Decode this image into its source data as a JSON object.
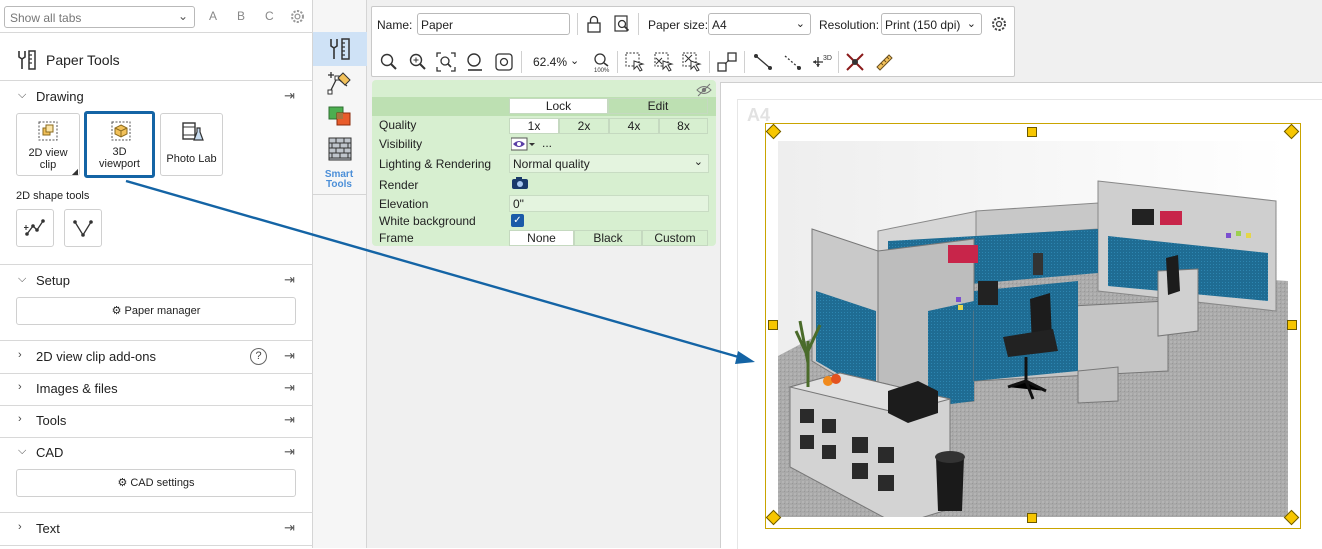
{
  "left_panel": {
    "tab_filter": {
      "value": "Show all tabs"
    },
    "letters": [
      "A",
      "B",
      "C"
    ],
    "title": "Paper Tools",
    "sections": {
      "drawing": "Drawing",
      "setup": "Setup",
      "addons": "2D view clip add-ons",
      "images": "Images & files",
      "tools": "Tools",
      "cad": "CAD",
      "text": "Text"
    },
    "tiles": {
      "view_clip_line1": "2D view",
      "view_clip_line2": "clip",
      "viewport_line1": "3D",
      "viewport_line2": "viewport",
      "photo_lab": "Photo Lab"
    },
    "shape_tools_label": "2D shape tools",
    "paper_manager": "Paper manager",
    "cad_settings": "CAD settings"
  },
  "strip": {
    "smart_line1": "Smart",
    "smart_line2": "Tools"
  },
  "toolbar": {
    "name_label": "Name:",
    "name_value": "Paper",
    "paper_size_label": "Paper size:",
    "paper_size_value": "A4",
    "resolution_label": "Resolution:",
    "resolution_value": "Print (150 dpi)",
    "zoom_value": "62.4%"
  },
  "properties": {
    "lock": "Lock",
    "edit": "Edit",
    "quality_label": "Quality",
    "quality_options": [
      "1x",
      "2x",
      "4x",
      "8x"
    ],
    "visibility_label": "Visibility",
    "visibility_more": "...",
    "lighting_label": "Lighting & Rendering",
    "lighting_value": "Normal quality",
    "render_label": "Render",
    "elevation_label": "Elevation",
    "elevation_value": "0\"",
    "white_bg_label": "White background",
    "white_bg_checked": true,
    "frame_label": "Frame",
    "frame_options": [
      "None",
      "Black",
      "Custom"
    ]
  },
  "paper": {
    "size_label": "A4"
  },
  "colors": {
    "accent": "#1464a5",
    "handle": "#f7c600",
    "panel_green": "#d7efd0"
  }
}
